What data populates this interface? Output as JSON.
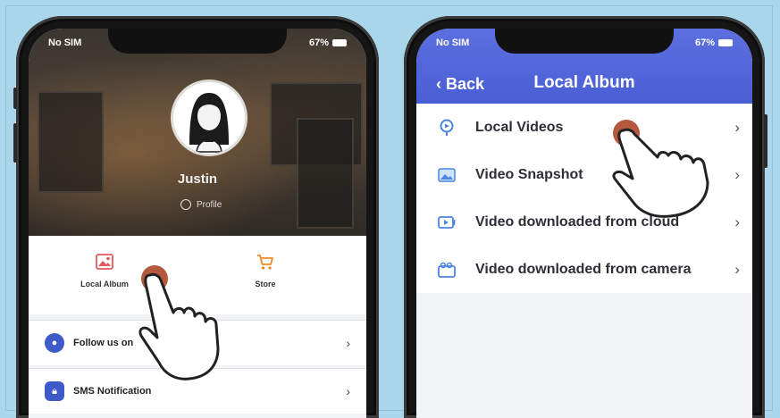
{
  "left_phone": {
    "status": {
      "carrier": "No SIM",
      "battery": "67%"
    },
    "profile": {
      "name": "Justin",
      "profile_link": "Profile"
    },
    "shortcuts": [
      {
        "label": "Local Album",
        "icon": "image-icon"
      },
      {
        "label": "Store",
        "icon": "cart-icon"
      }
    ],
    "menu": [
      {
        "label": "Follow us on",
        "icon": "follow-icon"
      },
      {
        "label": "SMS Notification",
        "icon": "lock-icon"
      }
    ]
  },
  "right_phone": {
    "status": {
      "carrier": "No SIM",
      "battery": "67%"
    },
    "nav": {
      "back_label": "Back",
      "title": "Local Album"
    },
    "items": [
      {
        "label": "Local Videos",
        "icon": "video-pin-icon"
      },
      {
        "label": "Video Snapshot",
        "icon": "photo-icon"
      },
      {
        "label": "Video downloaded from cloud",
        "icon": "cloud-video-icon"
      },
      {
        "label": "Video downloaded from camera",
        "icon": "camera-video-icon"
      }
    ]
  },
  "colors": {
    "accent": "#4b5fd5",
    "background": "#a9d6ea",
    "tap": "#b5593e"
  }
}
